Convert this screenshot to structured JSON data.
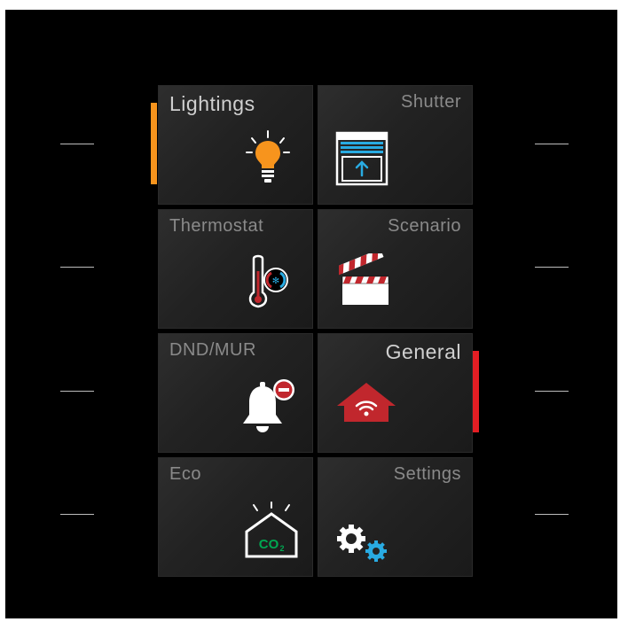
{
  "tiles": [
    {
      "label": "Lightings",
      "icon": "light-bulb-icon"
    },
    {
      "label": "Shutter",
      "icon": "shutter-icon"
    },
    {
      "label": "Thermostat",
      "icon": "thermostat-icon"
    },
    {
      "label": "Scenario",
      "icon": "clapperboard-icon"
    },
    {
      "label": "DND/MUR",
      "icon": "do-not-disturb-bell-icon"
    },
    {
      "label": "General",
      "icon": "smart-home-icon"
    },
    {
      "label": "Eco",
      "icon": "co2-house-icon"
    },
    {
      "label": "Settings",
      "icon": "gears-icon"
    }
  ],
  "co2_text": "CO",
  "co2_subscript": "2",
  "colors": {
    "background": "#000000",
    "tile": "#262626",
    "label": "#8a8a8a",
    "accent_left": "#f7941d",
    "accent_right": "#e31e24",
    "bulb": "#f7941d",
    "shutter": "#29abe2",
    "red": "#c1272d",
    "co2_green": "#00a651",
    "gear_blue": "#29abe2"
  }
}
